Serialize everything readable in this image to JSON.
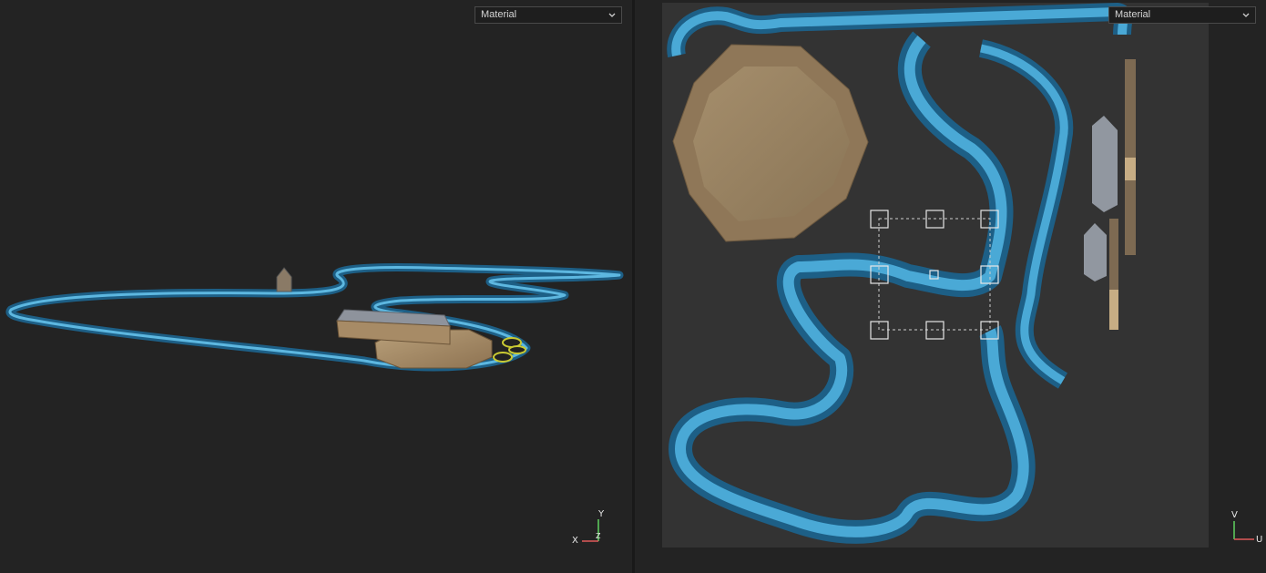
{
  "left_viewport": {
    "material_dropdown": {
      "value": "Material"
    },
    "axis_gizmo": {
      "x_label": "X",
      "y_label": "Y",
      "z_label": "Z"
    }
  },
  "right_viewport": {
    "material_dropdown": {
      "value": "Material"
    },
    "axis_gizmo": {
      "u_label": "U",
      "v_label": "V"
    }
  },
  "colors": {
    "river": "#3b98c4",
    "river_edge": "#1d5f86",
    "wood": "#b49a74",
    "wood_dark": "#7f6446",
    "roof": "#8e939c",
    "viewport_bg": "#232323",
    "uv_canvas_bg": "#333333"
  }
}
